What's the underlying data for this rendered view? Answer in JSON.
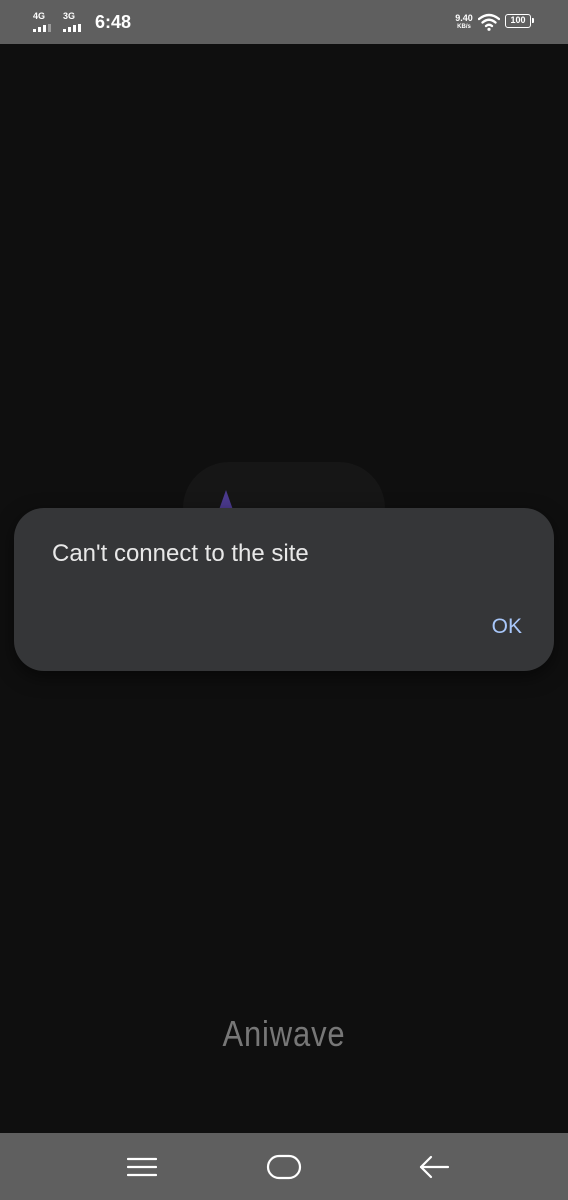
{
  "status_bar": {
    "sim1_network": "4G",
    "sim2_network": "3G",
    "time": "6:48",
    "net_speed_value": "9.40",
    "net_speed_unit": "KB/s",
    "battery_level": "100"
  },
  "splash": {
    "logo_accent_color": "#4b3a8e",
    "app_name": "Aniwave"
  },
  "dialog": {
    "message": "Can't connect to the site",
    "ok_label": "OK",
    "button_color": "#a8c7fa"
  },
  "nav_bar": {
    "recents_icon": "menu-lines-icon",
    "home_icon": "home-pill-icon",
    "back_icon": "back-arrow-icon"
  }
}
